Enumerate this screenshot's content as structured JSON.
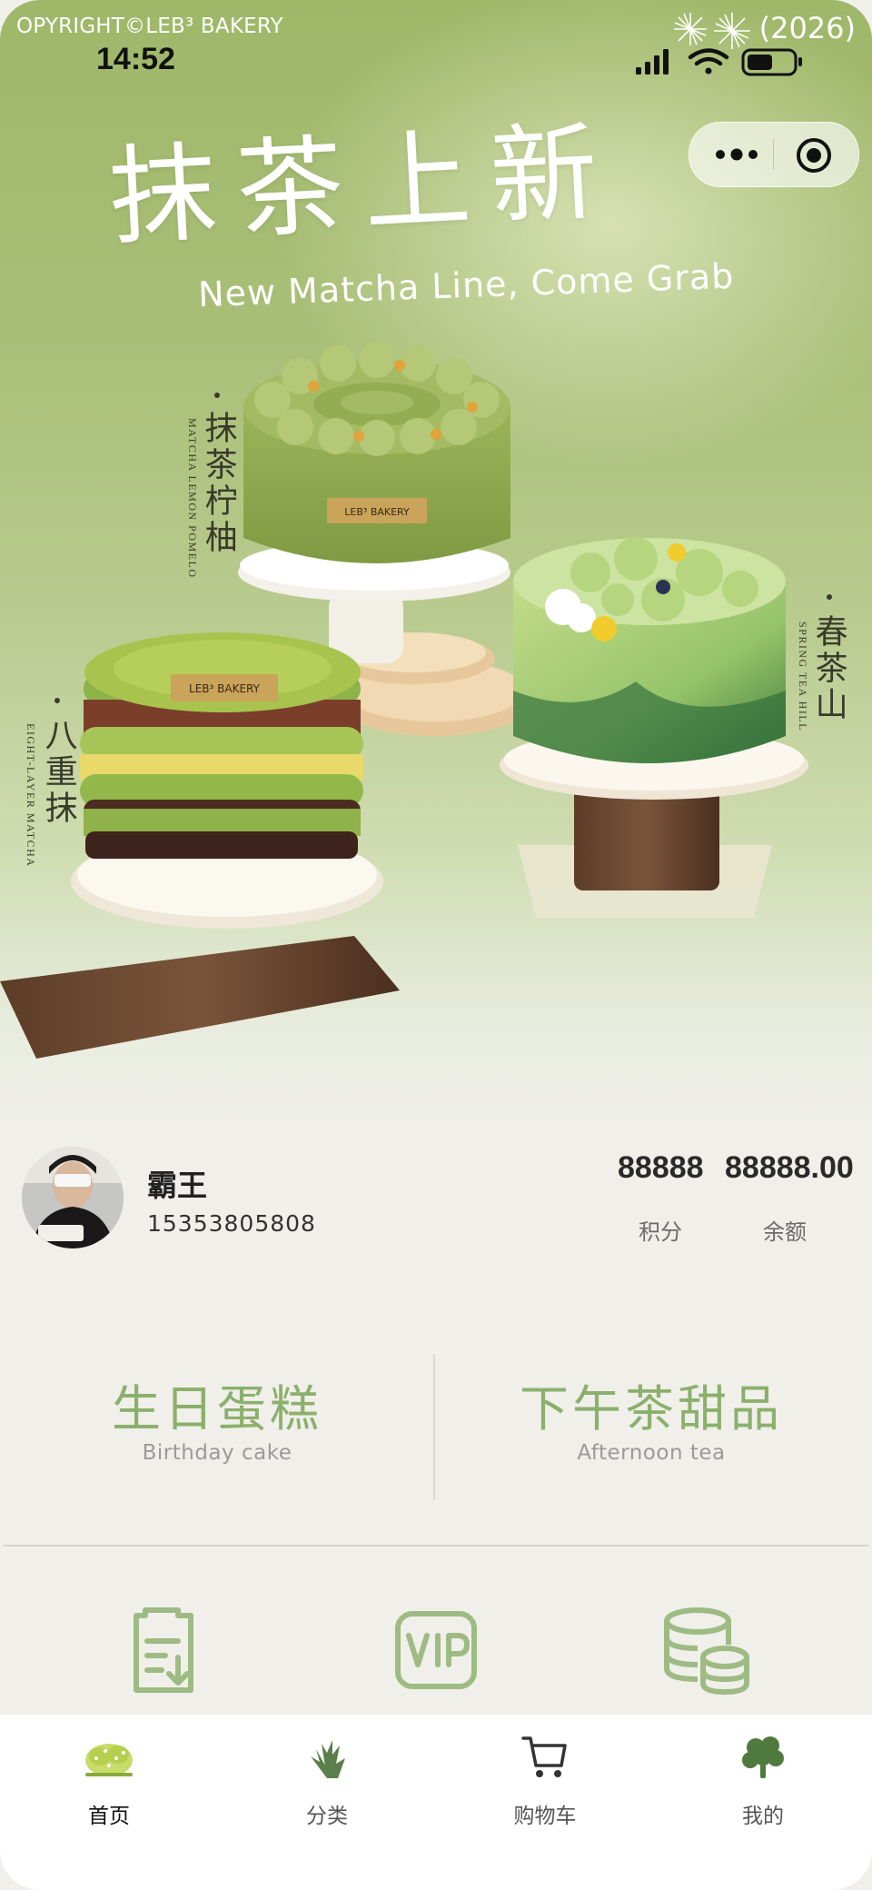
{
  "status_bar": {
    "copyright": "OPYRIGHT©LEB³ BAKERY",
    "year": "(2026)",
    "time": "14:52"
  },
  "hero": {
    "headline": "抹茶上新",
    "subline": "New Matcha Line, Come Grab",
    "labels": [
      {
        "cn": "抹茶柠柚",
        "en": "MATCHA LEMON POMELO"
      },
      {
        "cn": "春茶山",
        "en": "SPRING TEA HILL"
      },
      {
        "cn": "八重抹",
        "en": "EIGHT-LAYER MATCHA"
      }
    ],
    "cake_plaques": [
      "LEB³ BAKERY",
      "LEB³ BAKERY"
    ]
  },
  "user": {
    "name": "霸王",
    "phone": "15353805808",
    "points_value": "88888",
    "points_label": "积分",
    "balance_value": "88888.00",
    "balance_label": "余额"
  },
  "categories": [
    {
      "cn": "生日蛋糕",
      "en": "Birthday cake"
    },
    {
      "cn": "下午茶甜品",
      "en": "Afternoon tea"
    }
  ],
  "features": [
    {
      "icon": "order-clipboard-icon"
    },
    {
      "icon": "vip-icon"
    },
    {
      "icon": "coins-icon"
    }
  ],
  "tabbar": {
    "items": [
      {
        "label": "首页",
        "icon": "home-bush-icon",
        "active": true
      },
      {
        "label": "分类",
        "icon": "category-plant-icon",
        "active": false
      },
      {
        "label": "购物车",
        "icon": "cart-icon",
        "active": false
      },
      {
        "label": "我的",
        "icon": "profile-flower-icon",
        "active": false
      }
    ]
  },
  "colors": {
    "accent_green": "#8bb06c",
    "icon_green": "#9dbb83",
    "page_bg": "#f0efea"
  }
}
